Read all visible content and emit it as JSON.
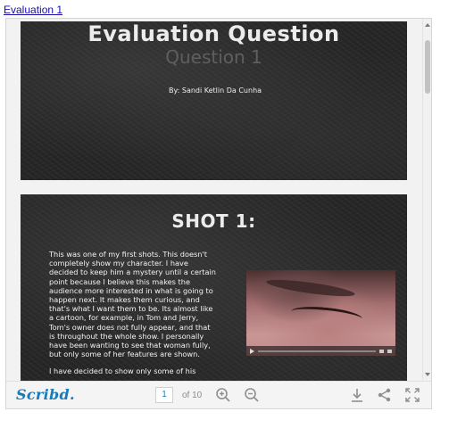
{
  "link": {
    "label": "Evaluation 1"
  },
  "slides": [
    {
      "title": "Evaluation Question",
      "subtitle": "Question 1",
      "byline": "By: Sandi Ketlin Da Cunha"
    },
    {
      "title": "SHOT 1:",
      "paragraphs": [
        "This was one of my first shots. This doesn't completely show my character. I have decided to keep him a mystery until a certain point because I believe this makes the audience more interested in what is going to happen next. It makes them curious, and that's what I want them to be. Its almost like a cartoon, for example, in Tom and Jerry, Tom's owner does not fully appear, and that is throughout the whole show. I personally have been wanting to see that woman fully, but only some of her features are shown.",
        "I have decided to show only some of his"
      ]
    }
  ],
  "toolbar": {
    "brand": "Scribd.",
    "current_page": "1",
    "page_total_label": "of 10",
    "icons": [
      "zoom-in-icon",
      "zoom-out-icon",
      "download-icon",
      "share-icon",
      "fullscreen-icon"
    ]
  },
  "colors": {
    "brand": "#1a7bba",
    "icon": "#8f8f8f",
    "slide_bg": "#262626"
  }
}
